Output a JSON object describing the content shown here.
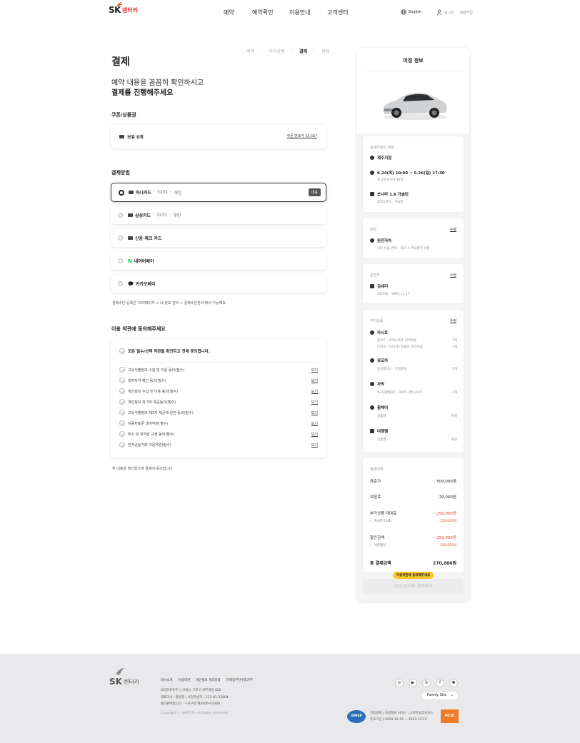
{
  "header": {
    "logo_sk": "SK",
    "logo_rent": "렌터카",
    "nav": [
      "예약",
      "예약확인",
      "이용안내",
      "고객센터"
    ],
    "lang": "English",
    "login": "로그인",
    "join": "회원가입"
  },
  "page": {
    "title": "결제",
    "steps": [
      "예약",
      "부가상품",
      "결제",
      "완료"
    ],
    "headline1": "예약 내용을 꼼꼼히 확인하시고",
    "headline2": "결제를 진행해주세요"
  },
  "coupon": {
    "section": "쿠폰/상품권",
    "owned": "보유 0개",
    "link": "쿠폰 번호가 있나요?"
  },
  "payment": {
    "section": "결제방법",
    "methods": [
      {
        "name": "하나카드",
        "num": "3231",
        "type": "개인",
        "badge": "대표"
      },
      {
        "name": "삼성카드",
        "num": "3231",
        "type": "개인"
      },
      {
        "name": "신용·체크 카드"
      },
      {
        "name": "네이버페이"
      },
      {
        "name": "카카오페이"
      }
    ],
    "note": "결제수단 등록은 '마이페이지 > 내 정보 관리 > 결제수단관리'에서 가능해요."
  },
  "terms": {
    "section": "이용 약관에 동의해주세요",
    "all": "모든 필수/선택 약관을 확인하고 전체 동의합니다.",
    "items": [
      "고유식별정보 수집 및 이용 동의(필수)",
      "대여자격 확인 동의(필수)",
      "개인정보 수집 및 이용 동의(필수)",
      "개인정보 제 3자 제공동의(필수)",
      "고유식별정보 제3자 제공에 관한 동의(필수)",
      "자동차표준 대여약관(필수)",
      "취소 및 위약금 규정 동의(필수)",
      "전자금융거래 이용약관(필수)"
    ],
    "view": "보기",
    "after": "위 내용을 확인했으며 결제에 동의합니다"
  },
  "trip": {
    "title": "여정 정보",
    "trip_cap": "김세리님의 여정",
    "branch": "제주지점",
    "datetime": "6.24(목) 10:00 ~ 6.26(일) 17:30",
    "duration": "총 2일 6시간 30분",
    "car": "쏘나타 1.6 가솔린",
    "car_sub": "2021년식 · 가솔린",
    "ins_cap": "보험",
    "ins": "완전자차",
    "ins_sub": "모든 비용 면책 · 사고 시 주요항목 보험",
    "driver_cap": "운전자",
    "driver": "김세리",
    "driver_sub": "2종보통 · 1995.11.27",
    "addon_cap": "부가상품",
    "edit": "수정",
    "addons": [
      {
        "name": "카시트",
        "lines": [
          [
            "플코드 · 루이스톡즈 아이바운",
            "1개"
          ],
          [
            "다이치 · 브이가드토들러 프리미엄",
            "1개"
          ]
        ]
      },
      {
        "name": "유모차",
        "lines": [
          [
            "잉글레시나 · 트립로지",
            "2개"
          ]
        ]
      },
      {
        "name": "자박",
        "lines": [
          [
            "녹고하캠핑장 · 하쿠마 3면 사이트",
            "2개"
          ]
        ]
      },
      {
        "name": "휠체어",
        "lines": [
          [
            "상품명",
            "수량"
          ]
        ]
      },
      {
        "name": "여행템",
        "lines": [
          [
            "상품명",
            "수량"
          ]
        ]
      }
    ],
    "pay_cap": "결제내역",
    "rows": [
      {
        "label": "표준가",
        "value": "500,000원"
      },
      {
        "label": "보험료",
        "value": "20,000원"
      }
    ],
    "addon_total_label": "부가상품 대여료",
    "addon_total": "- 250,000원",
    "addon_detail_label": "ㄴ 카시트 (1개)",
    "addon_detail": "- 250,000원",
    "disc_label": "할인금액",
    "disc": "- 250,000원",
    "disc_detail_label": "ㄴ 시즌할인",
    "disc_detail": "- 250,000원",
    "total_label": "총 결제금액",
    "total": "270,000원",
    "tooltip": "이용약관에 동의해주세요",
    "pay_button": "250,000원 결제하기"
  },
  "footer": {
    "links": [
      "회사소개",
      "이용약관",
      "개인정보 처리방침",
      "이메일무단수집거부"
    ],
    "info1": "SK렌터카(주) | 서울시 구로구 서부샛길 822",
    "info2": "대표이사 : 황일문 | 사업자번호 : 113-81-32864",
    "info3": "통신판매업신고 : 구로구청 제2006-03389",
    "copy": "Copyright ⓒ SK렌터카. All Rights Reserved.",
    "family": "Family Site",
    "isms": "ISMSP",
    "cert1": "인증범위 | 차량렌탈 서비스 , 스마트링크서비스",
    "cert2": "유효기간 | 2020-12-16 ~ 2023-12-15",
    "ncsi": "NCSI",
    "colors": {
      "accent": "#e8362b",
      "tooltip": "#ffc629"
    }
  }
}
